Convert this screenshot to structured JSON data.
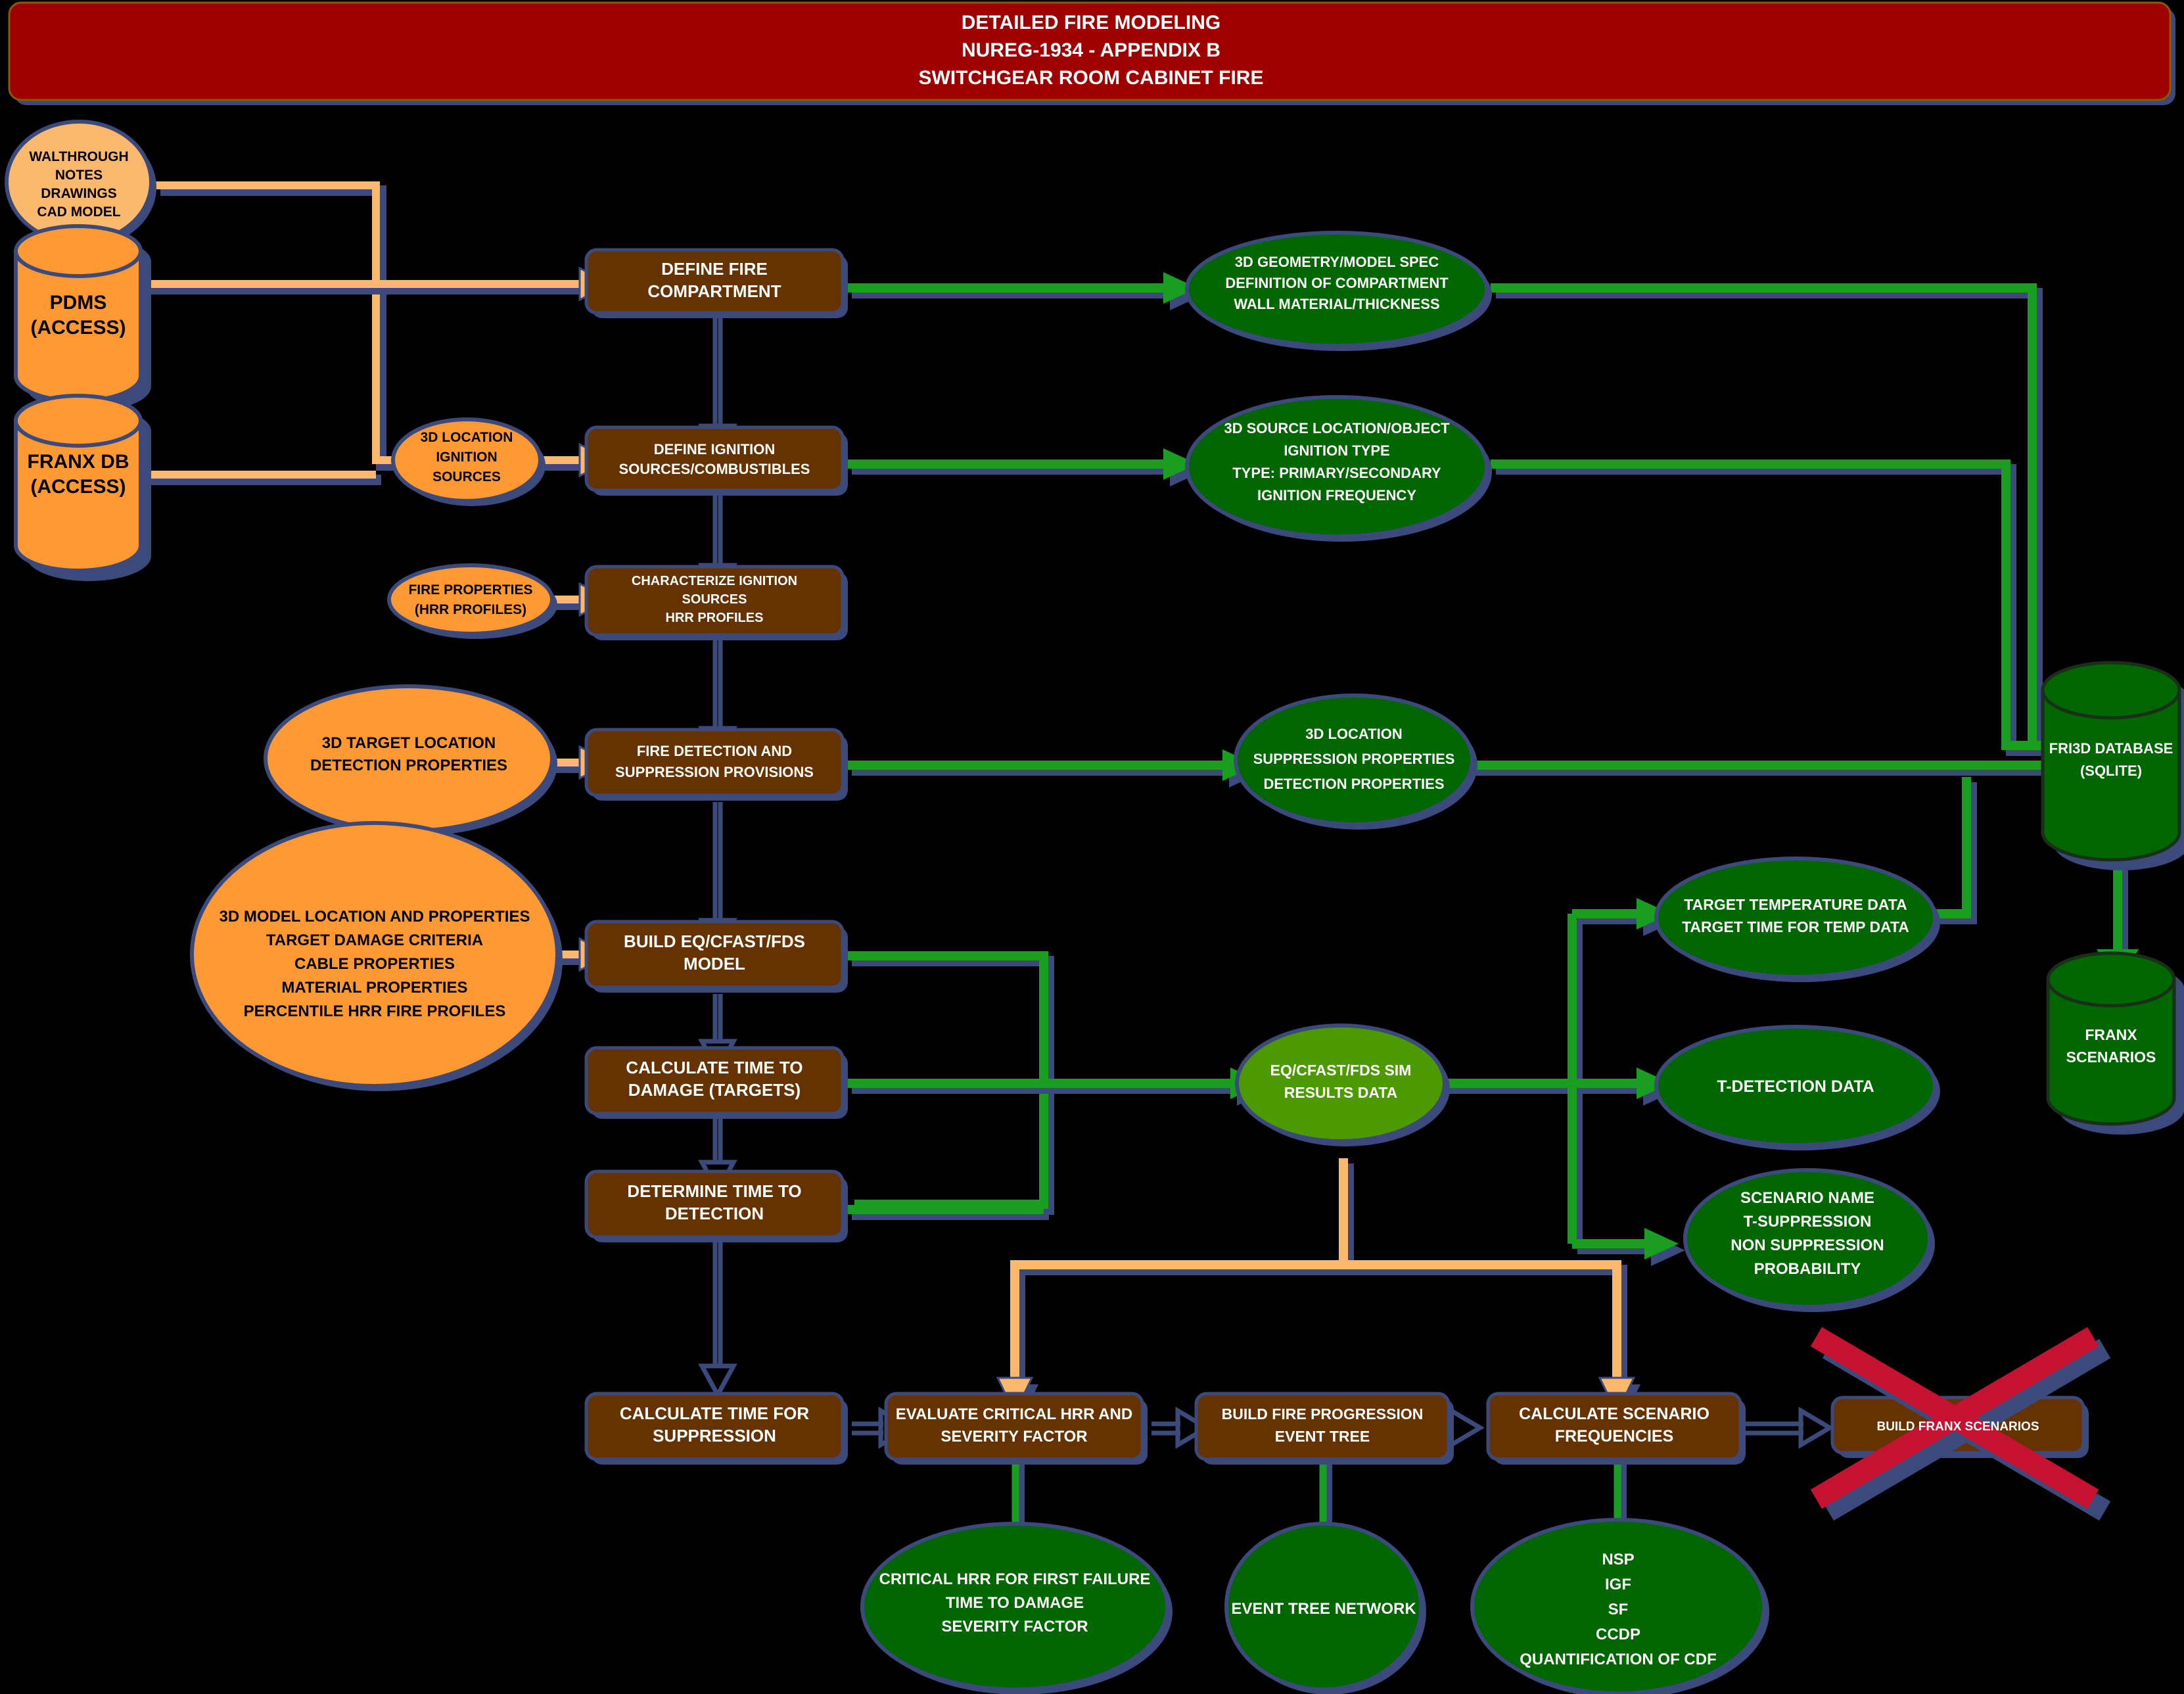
{
  "header": {
    "line1": "DETAILED FIRE MODELING",
    "line2": "NUREG-1934 - APPENDIX B",
    "line3": "SWITCHGEAR ROOM CABINET FIRE",
    "bg": "#9e0000",
    "text_color": "#ffffff"
  },
  "colors": {
    "background": "#000000",
    "process_box": "#663300",
    "data_green": "#006600",
    "sim_green": "#4d9a00",
    "source_orange": "#ff9933",
    "source_orange_light": "#fbb96e",
    "shadow_blue": "#3b4a7a",
    "arrow_orange": "#fcb96e",
    "arrow_green": "#1a9e22",
    "arrow_blue": "#2e3d6e",
    "strike_red": "#c51230",
    "strike_red_dark": "#a8001e"
  },
  "sources": {
    "walkthrough": "WALTHROUGH\nNOTES\nDRAWINGS\nCAD MODEL",
    "pdms": "PDMS\n(ACCESS)",
    "franx_db": "FRANX DB\n(ACCESS)",
    "loc_ignition": "3D LOCATION\nIGNITION\nSOURCES",
    "fire_props": "FIRE PROPERTIES\n(HRR PROFILES)",
    "target_loc": "3D TARGET LOCATION\nDETECTION PROPERTIES",
    "model_props": "3D MODEL LOCATION AND PROPERTIES\nTARGET DAMAGE CRITERIA\nCABLE PROPERTIES\nMATERIAL PROPERTIES\nPERCENTILE HRR FIRE PROFILES"
  },
  "process": {
    "define_compartment": "DEFINE FIRE\nCOMPARTMENT",
    "define_ignition": "DEFINE IGNITION\nSOURCES/COMBUSTIBLES",
    "characterize": "CHARACTERIZE IGNITION\nSOURCES\nHRR PROFILES",
    "detection_suppression": "FIRE DETECTION AND\nSUPPRESSION PROVISIONS",
    "build_model": "BUILD EQ/CFAST/FDS\nMODEL",
    "time_damage": "CALCULATE TIME TO\nDAMAGE (TARGETS)",
    "time_detection": "DETERMINE TIME TO\nDETECTION",
    "time_suppression": "CALCULATE TIME FOR\nSUPPRESSION",
    "evaluate_hrr": "EVALUATE CRITICAL HRR AND\nSEVERITY FACTOR",
    "event_tree": "BUILD FIRE PROGRESSION\nEVENT TREE",
    "scenario_freq": "CALCULATE SCENARIO\nFREQUENCIES",
    "build_franx": "BUILD FRANX SCENARIOS"
  },
  "data_nodes": {
    "geometry": "3D GEOMETRY/MODEL SPEC\nDEFINITION OF COMPARTMENT\nWALL MATERIAL/THICKNESS",
    "source_loc": "3D SOURCE LOCATION/OBJECT\nIGNITION TYPE\nTYPE: PRIMARY/SECONDARY\nIGNITION FREQUENCY",
    "loc_suppression": "3D LOCATION\nSUPPRESSION PROPERTIES\nDETECTION PROPERTIES",
    "sim_results": "EQ/CFAST/FDS SIM\nRESULTS DATA",
    "target_temp": "TARGET TEMPERATURE DATA\nTARGET TIME FOR TEMP DATA",
    "t_detection": "T-DETECTION DATA",
    "scenario_name": "SCENARIO NAME\nT-SUPPRESSION\nNON SUPPRESSION\nPROBABILITY",
    "critical_hrr": "CRITICAL HRR FOR FIRST FAILURE\nTIME TO DAMAGE\nSEVERITY FACTOR",
    "event_tree_net": "EVENT TREE NETWORK",
    "quantification": "NSP\nIGF\nSF\nCCDP\nQUANTIFICATION OF CDF"
  },
  "databases": {
    "fri3d": "FRI3D DATABASE\n(SQLITE)",
    "franx_scenarios": "FRANX\nSCENARIOS"
  }
}
